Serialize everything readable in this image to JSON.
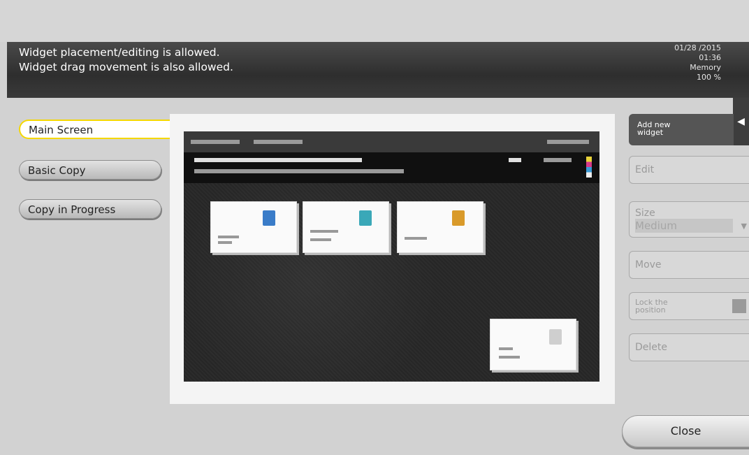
{
  "header": {
    "message_line1": "Widget placement/editing is allowed.",
    "message_line2": "Widget drag movement is also allowed.",
    "date": "01/28 /2015",
    "time": "01:36",
    "memory_label": "Memory",
    "memory_value": "100 %"
  },
  "tabs": [
    {
      "label": "Main Screen",
      "active": true
    },
    {
      "label": "Basic Copy",
      "active": false
    },
    {
      "label": "Copy in Progress",
      "active": false
    }
  ],
  "side": {
    "add_widget_line1": "Add new",
    "add_widget_line2": "widget",
    "edit": "Edit",
    "size_label": "Size",
    "size_value": "Medium",
    "move": "Move",
    "lock_line1": "Lock the",
    "lock_line2": "position",
    "delete": "Delete",
    "collapse_icon": "chevron-left-icon"
  },
  "close": "Close",
  "colors": {
    "header_bg": "#333333",
    "active_tab_border": "#f5d800",
    "widget_icon_blue": "#3a7cc8",
    "widget_icon_teal": "#3aa8b8",
    "widget_icon_orange": "#d99a2a"
  }
}
